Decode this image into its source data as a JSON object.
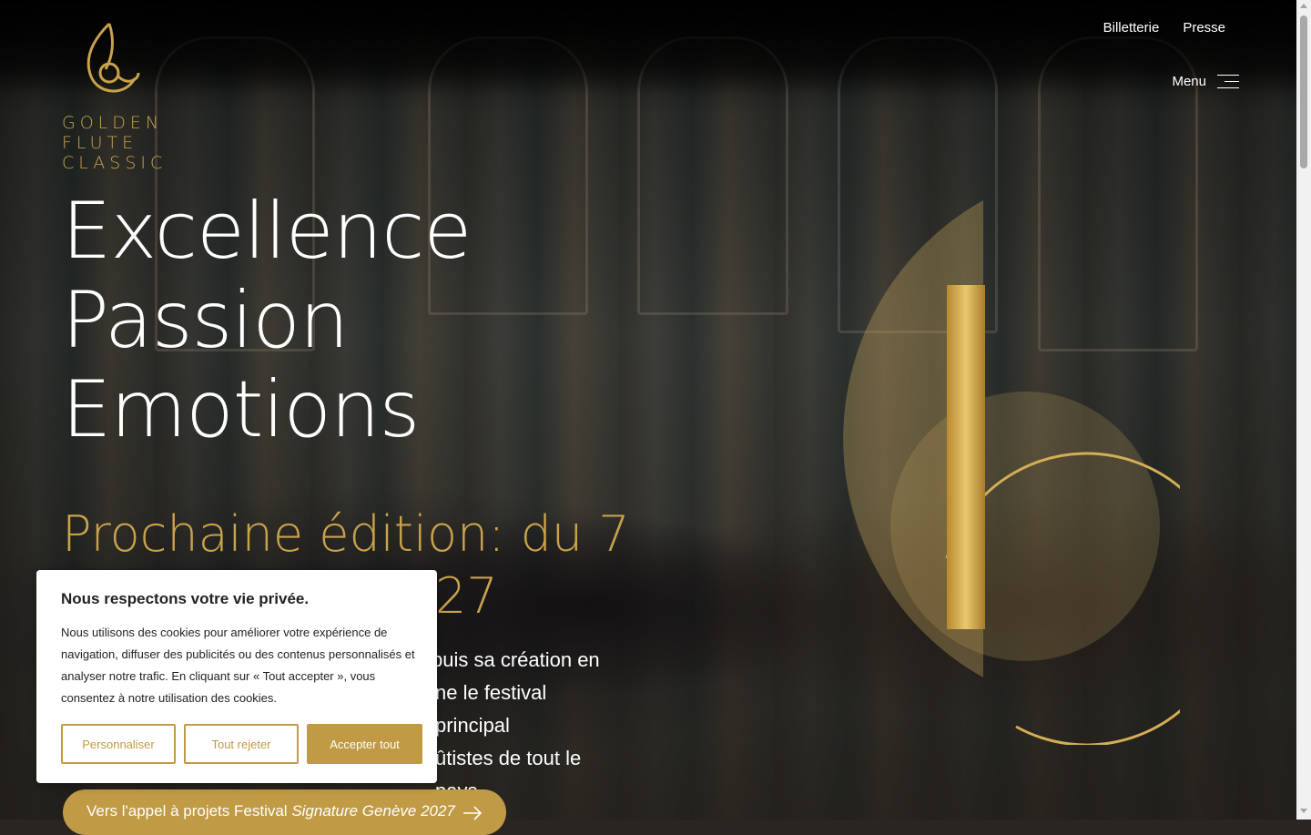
{
  "brand": {
    "logo_lines": [
      "GOLDEN",
      "FLUTE",
      "CLASSIC"
    ],
    "gold": "#c09a45"
  },
  "nav": {
    "links": [
      "Billetterie",
      "Presse"
    ],
    "menu_label": "Menu"
  },
  "hero": {
    "headline": [
      "Excellence",
      "Passion",
      "Emotions"
    ],
    "edition": "Prochaine édition: du 7 ... 2027",
    "edition_visible_start": "Prochaine édition: du 7",
    "edition_visible_end": "27",
    "description_lines": [
      "puis sa création en",
      "ne le festival principal",
      "ûtistes de tout le pays"
    ],
    "cta_text": "Vers l'appel à projets Festival ",
    "cta_italic": "Signature Genève 2027",
    "cta_icon": "arrow-right-icon"
  },
  "cookie_banner": {
    "title": "Nous respectons votre vie privée.",
    "body": "Nous utilisons des cookies pour améliorer votre expérience de navigation, diffuser des publicités ou des contenus personnalisés et analyser notre trafic. En cliquant sur « Tout accepter », vous consentez à notre utilisation des cookies.",
    "customize_label": "Personnaliser",
    "reject_label": "Tout rejeter",
    "accept_label": "Accepter tout"
  }
}
